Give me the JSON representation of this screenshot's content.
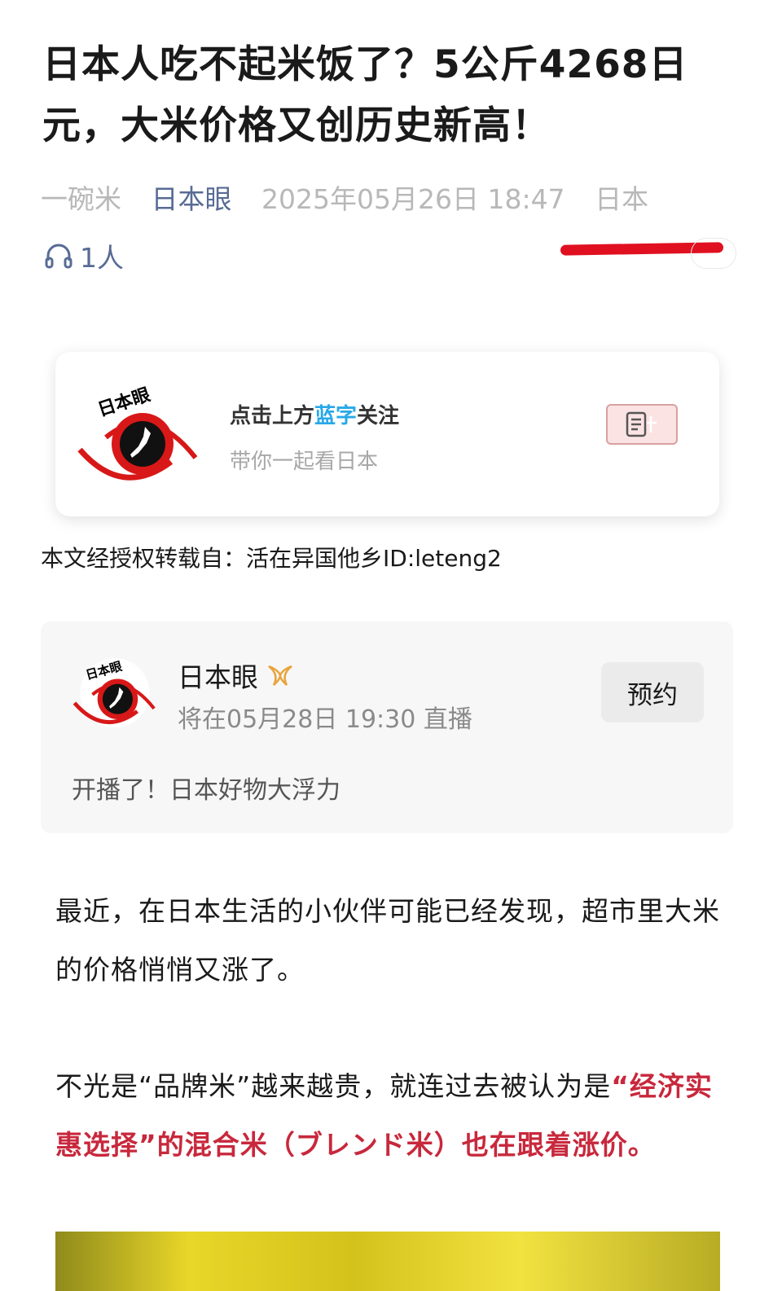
{
  "article": {
    "title": "日本人吃不起米饭了？5公斤4268日元，大米价格又创历史新高！",
    "author": "一碗米",
    "account": "日本眼",
    "datetime": "2025年05月26日 18:47",
    "location": "日本",
    "listeners": "1人"
  },
  "follow_card": {
    "title_pre": "点击上方",
    "title_blue": "蓝字",
    "title_post": "关注",
    "subtitle": "带你一起看日本",
    "logo_text": "日本眼"
  },
  "repost_note": "本文经授权转载自：活在异国他乡ID:leteng2",
  "live_card": {
    "name": "日本眼",
    "schedule": "将在05月28日 19:30 直播",
    "button": "预约",
    "description": "开播了！日本好物大浮力"
  },
  "paragraphs": {
    "p1": "最近，在日本生活的小伙伴可能已经发现，超市里大米的价格悄悄又涨了。",
    "p2_normal": "不光是“品牌米”越来越贵，就连过去被认为是",
    "p2_highlight": "“经济实惠选择”的混合米（ブレンド米）也在跟着涨价。"
  },
  "colors": {
    "link_blue": "#576b95",
    "highlight_red": "#c8283c",
    "annotation_red": "#e01020"
  }
}
